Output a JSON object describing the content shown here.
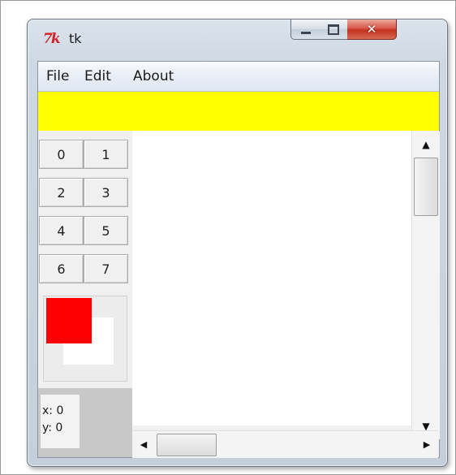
{
  "window": {
    "icon_text": "7k",
    "title": "tk",
    "controls": {
      "minimize": "minimize",
      "maximize": "maximize",
      "close": "close"
    }
  },
  "menubar": {
    "items": [
      "File",
      "Edit",
      "About"
    ]
  },
  "banner": {
    "color": "#ffff00"
  },
  "button_grid": [
    [
      "0",
      "1"
    ],
    [
      "2",
      "3"
    ],
    [
      "4",
      "5"
    ],
    [
      "6",
      "7"
    ]
  ],
  "canvas": {
    "square_color": "#ff0000"
  },
  "coords": {
    "x": "x: 0",
    "y": "y: 0"
  },
  "scrollbars": {
    "vertical": {
      "up": "▲",
      "down": "▼"
    },
    "horizontal": {
      "left": "◀",
      "right": "▶"
    }
  }
}
